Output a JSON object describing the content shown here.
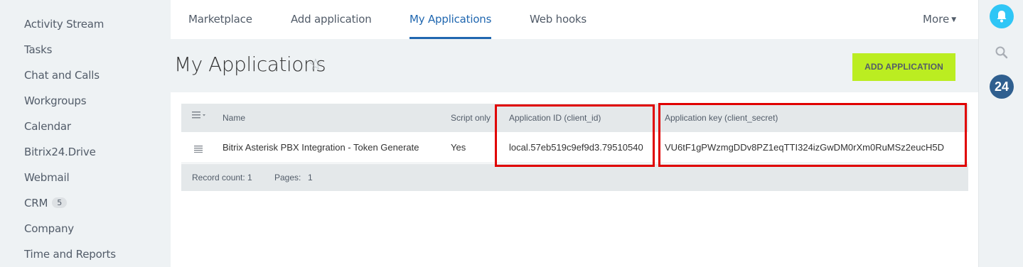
{
  "sidebar": {
    "items": [
      {
        "label": "Activity Stream"
      },
      {
        "label": "Tasks"
      },
      {
        "label": "Chat and Calls"
      },
      {
        "label": "Workgroups"
      },
      {
        "label": "Calendar"
      },
      {
        "label": "Bitrix24.Drive"
      },
      {
        "label": "Webmail"
      },
      {
        "label": "CRM",
        "badge": "5"
      },
      {
        "label": "Company"
      },
      {
        "label": "Time and Reports"
      }
    ]
  },
  "nav": {
    "tabs": [
      {
        "label": "Marketplace"
      },
      {
        "label": "Add application"
      },
      {
        "label": "My Applications",
        "active": true
      },
      {
        "label": "Web hooks"
      }
    ],
    "more_label": "More"
  },
  "page": {
    "title": "My Applications",
    "add_button": "ADD APPLICATION"
  },
  "grid": {
    "headers": [
      "Name",
      "Script only",
      "Application ID (client_id)",
      "Application key (client_secret)"
    ],
    "rows": [
      {
        "name": "Bitrix Asterisk PBX Integration - Token Generate",
        "script_only": "Yes",
        "client_id": "local.57eb519c9ef9d3.79510540",
        "client_secret": "VU6tF1gPWzmgDDv8PZ1eqTTI324izGwDM0rXm0RuMSz2eucH5D"
      }
    ],
    "footer": {
      "record_count_label": "Record count: 1",
      "pages_label": "Pages:",
      "pages_value": "1"
    }
  },
  "colors": {
    "accent": "#2067b0",
    "add_button_bg": "#bbed21",
    "highlight": "#e00000",
    "bell": "#2fc6f6",
    "b24_logo": "#2f5f8f"
  },
  "right_panel": {
    "icons": [
      "bell-icon",
      "search-icon",
      "bitrix24-logo"
    ],
    "logo_text": "24"
  }
}
